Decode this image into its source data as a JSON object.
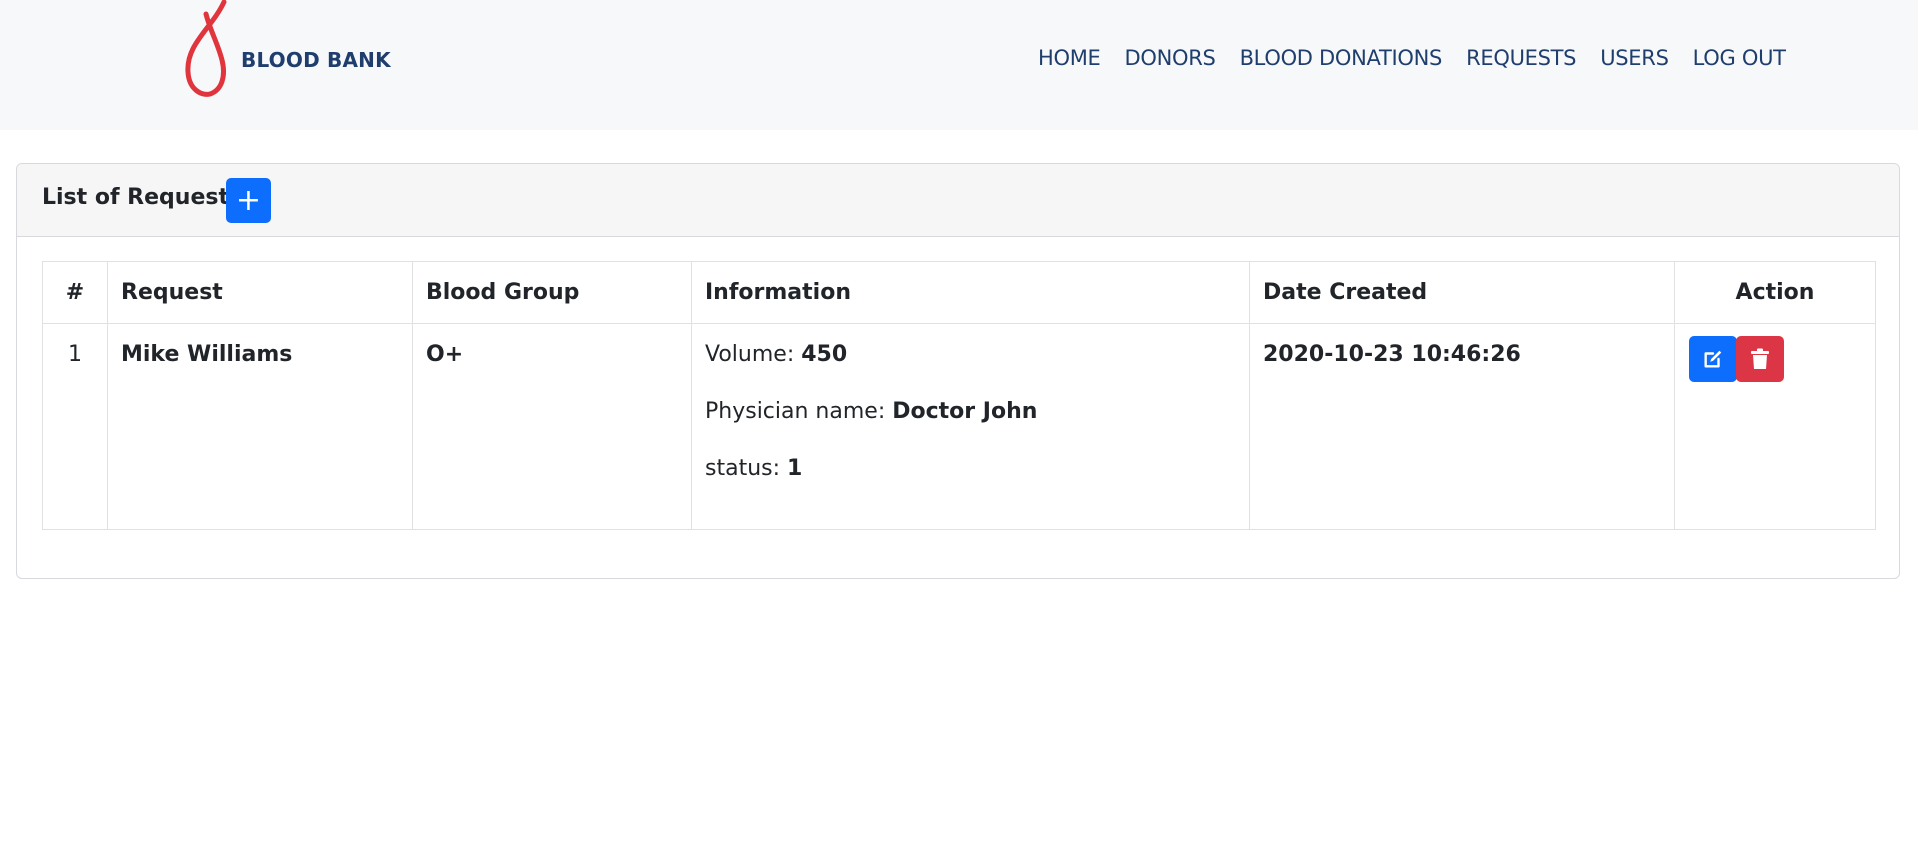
{
  "brand": {
    "name": "BLOOD BANK",
    "logo_color": "#e0353d",
    "text_color": "#1f3e6e"
  },
  "nav": {
    "items": [
      {
        "id": "home",
        "label": "HOME"
      },
      {
        "id": "donors",
        "label": "DONORS"
      },
      {
        "id": "blood-donations",
        "label": "BLOOD DONATIONS"
      },
      {
        "id": "requests",
        "label": "REQUESTS"
      },
      {
        "id": "users",
        "label": "USERS"
      },
      {
        "id": "logout",
        "label": "LOG OUT"
      }
    ]
  },
  "card": {
    "title": "List of Requests",
    "add_icon": "plus-icon",
    "add_label": "+"
  },
  "table": {
    "headers": [
      "#",
      "Request",
      "Blood Group",
      "Information",
      "Date Created",
      "Action"
    ],
    "rows": [
      {
        "index": "1",
        "request": "Mike Williams",
        "blood_group": "O+",
        "info": {
          "volume_label": "Volume: ",
          "volume_value": "450",
          "physician_label": "Physician name: ",
          "physician_value": "Doctor John",
          "status_label": "status: ",
          "status_value": "1"
        },
        "date_created": "2020-10-23 10:46:26",
        "actions": {
          "edit_icon": "edit-icon",
          "delete_icon": "trash-icon"
        }
      }
    ]
  },
  "colors": {
    "primary": "#0d6efd",
    "danger": "#dc3545"
  }
}
